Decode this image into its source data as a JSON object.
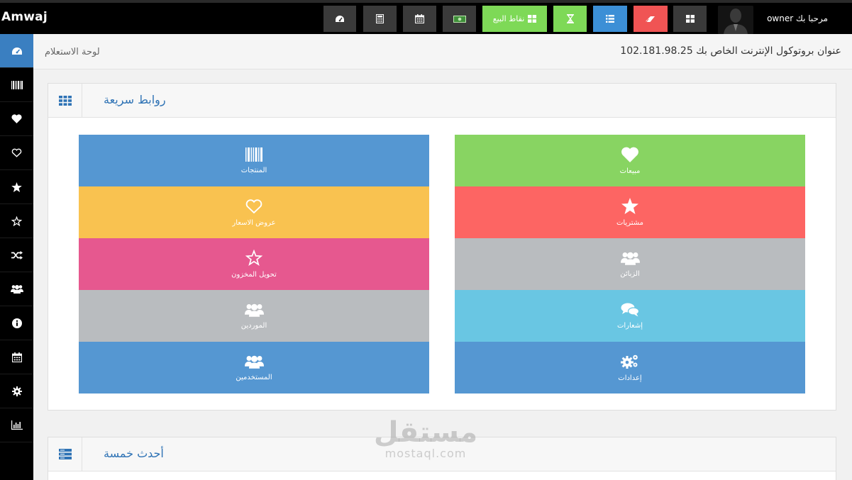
{
  "app": {
    "brand": "Amwaj"
  },
  "topbar": {
    "welcome": "مرحبا بك owner",
    "pos_label": "نقاط البيع",
    "buttons": [
      {
        "name": "dashboard-button",
        "icon": "dashboard-icon",
        "color": "#3a3a3a"
      },
      {
        "name": "calculator-button",
        "icon": "calculator-icon",
        "color": "#3a3a3a"
      },
      {
        "name": "calendar-button",
        "icon": "calendar-icon",
        "color": "#3a3a3a"
      },
      {
        "name": "money-button",
        "icon": "money-icon",
        "color": "#3a3a3a"
      },
      {
        "name": "pos-button",
        "icon": "grid-icon",
        "color": "#7ed957"
      },
      {
        "name": "hourglass-button",
        "icon": "hourglass-icon",
        "color": "#7ed957"
      },
      {
        "name": "list-button",
        "icon": "list-icon",
        "color": "#3c8fd6"
      },
      {
        "name": "eraser-button",
        "icon": "eraser-icon",
        "color": "#f05454"
      },
      {
        "name": "apps-button",
        "icon": "grid-icon",
        "color": "#3a3a3a"
      }
    ]
  },
  "header": {
    "ip_text": "عنوان بروتوكول الإنترنت الخاص بك 102.181.98.25",
    "dashboard_label": "لوحة الاستعلام"
  },
  "sidebar": {
    "items": [
      {
        "icon": "dashboard-icon"
      },
      {
        "icon": "barcode-icon"
      },
      {
        "icon": "heart-icon"
      },
      {
        "icon": "heart-outline-icon"
      },
      {
        "icon": "star-icon"
      },
      {
        "icon": "star-outline-icon"
      },
      {
        "icon": "shuffle-icon"
      },
      {
        "icon": "users-icon"
      },
      {
        "icon": "info-icon"
      },
      {
        "icon": "calendar-icon"
      },
      {
        "icon": "gear-icon"
      },
      {
        "icon": "bar-chart-icon"
      }
    ]
  },
  "quick_links": {
    "title": "روابط سريعة",
    "left": [
      {
        "label": "المنتجات",
        "icon": "barcode-icon",
        "color": "#5597d2"
      },
      {
        "label": "عروض الاسعار",
        "icon": "heart-outline-icon",
        "color": "#f9c250"
      },
      {
        "label": "تحويل المخزون",
        "icon": "star-outline-icon",
        "color": "#e6588f"
      },
      {
        "label": "الموردين",
        "icon": "users-icon",
        "color": "#b9bcbf"
      },
      {
        "label": "المستخدمين",
        "icon": "users-icon",
        "color": "#5597d2"
      }
    ],
    "right": [
      {
        "label": "مبيعات",
        "icon": "heart-icon",
        "color": "#88d462"
      },
      {
        "label": "مشتريات",
        "icon": "star-icon",
        "color": "#fd6563"
      },
      {
        "label": "الزبائن",
        "icon": "users-icon",
        "color": "#b9bcbf"
      },
      {
        "label": "إشعارات",
        "icon": "comments-icon",
        "color": "#69c6e3"
      },
      {
        "label": "إعدادات",
        "icon": "gears-icon",
        "color": "#5597d2"
      }
    ]
  },
  "latest": {
    "title": "أحدث خمسة"
  },
  "watermark": {
    "arabic": "مستقل",
    "latin": "mostaql.com"
  }
}
